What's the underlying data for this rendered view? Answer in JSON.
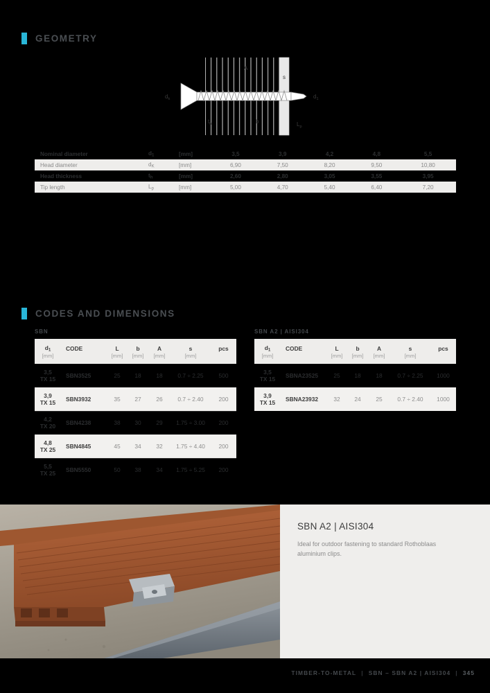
{
  "geometry": {
    "section_title": "GEOMETRY",
    "diagram": {
      "labels": {
        "head_diameter": "dk",
        "nominal_diameter": "d1",
        "thread_length": "A",
        "plate_thickness": "s",
        "head_thickness": "th",
        "b": "b",
        "tip_length": "Lp"
      }
    },
    "table": {
      "rows": [
        {
          "label": "Nominal diameter",
          "symbol": "d",
          "sub": "1",
          "unit": "[mm]",
          "values": [
            "3,5",
            "3,9",
            "4,2",
            "4,8",
            "5,5"
          ],
          "style": "dark"
        },
        {
          "label": "Head diameter",
          "symbol": "d",
          "sub": "K",
          "unit": "[mm]",
          "values": [
            "6,90",
            "7,50",
            "8,20",
            "9,50",
            "10,80"
          ],
          "style": "light"
        },
        {
          "label": "Head thickness",
          "symbol": "t",
          "sub": "h",
          "unit": "[mm]",
          "values": [
            "2,60",
            "2,80",
            "3,05",
            "3,55",
            "3,95"
          ],
          "style": "dark"
        },
        {
          "label": "Tip length",
          "symbol": "L",
          "sub": "p",
          "unit": "[mm]",
          "values": [
            "5,00",
            "4,70",
            "5,40",
            "6,40",
            "7,20"
          ],
          "style": "light"
        }
      ]
    }
  },
  "codes": {
    "section_title": "CODES AND DIMENSIONS",
    "headers": {
      "d1": "d",
      "d1_sub": "1",
      "code": "CODE",
      "l": "L",
      "b": "b",
      "a": "A",
      "s": "s",
      "pcs": "pcs",
      "unit": "[mm]"
    },
    "tables": [
      {
        "caption": "SBN",
        "rows": [
          {
            "d1": "3,5",
            "drive": "TX 15",
            "code": "SBN3525",
            "l": "25",
            "b": "18",
            "a": "18",
            "s": "0.7 ÷ 2.25",
            "pcs": "500",
            "style": "dark"
          },
          {
            "d1": "3,9",
            "drive": "TX 15",
            "code": "SBN3932",
            "l": "35",
            "b": "27",
            "a": "26",
            "s": "0.7 ÷ 2.40",
            "pcs": "200",
            "style": "light"
          },
          {
            "d1": "4,2",
            "drive": "TX 20",
            "code": "SBN4238",
            "l": "38",
            "b": "30",
            "a": "29",
            "s": "1.75 ÷ 3.00",
            "pcs": "200",
            "style": "dark"
          },
          {
            "d1": "4,8",
            "drive": "TX 25",
            "code": "SBN4845",
            "l": "45",
            "b": "34",
            "a": "32",
            "s": "1.75 ÷ 4.40",
            "pcs": "200",
            "style": "light"
          },
          {
            "d1": "5,5",
            "drive": "TX 25",
            "code": "SBN5550",
            "l": "50",
            "b": "38",
            "a": "34",
            "s": "1.75 ÷ 5.25",
            "pcs": "200",
            "style": "dark"
          }
        ]
      },
      {
        "caption": "SBN A2 | AISI304",
        "rows": [
          {
            "d1": "3,5",
            "drive": "TX 15",
            "code": "SBNA23525",
            "l": "25",
            "b": "18",
            "a": "18",
            "s": "0.7 ÷ 2.25",
            "pcs": "1000",
            "style": "dark"
          },
          {
            "d1": "3,9",
            "drive": "TX 15",
            "code": "SBNA23932",
            "l": "32",
            "b": "24",
            "a": "25",
            "s": "0.7 ÷ 2.40",
            "pcs": "1000",
            "style": "light"
          }
        ]
      }
    ]
  },
  "info_panel": {
    "title": "SBN A2 | AISI304",
    "text": "Ideal for outdoor fastening to standard Rothoblaas aluminium clips."
  },
  "footer": {
    "category": "TIMBER-TO-METAL",
    "product": "SBN – SBN A2 | AISI304",
    "page": "345",
    "divider": "|"
  },
  "colors": {
    "accent": "#29b6d8",
    "background": "#000000",
    "panel": "#efeeec",
    "light_row": "#eeedeb"
  }
}
